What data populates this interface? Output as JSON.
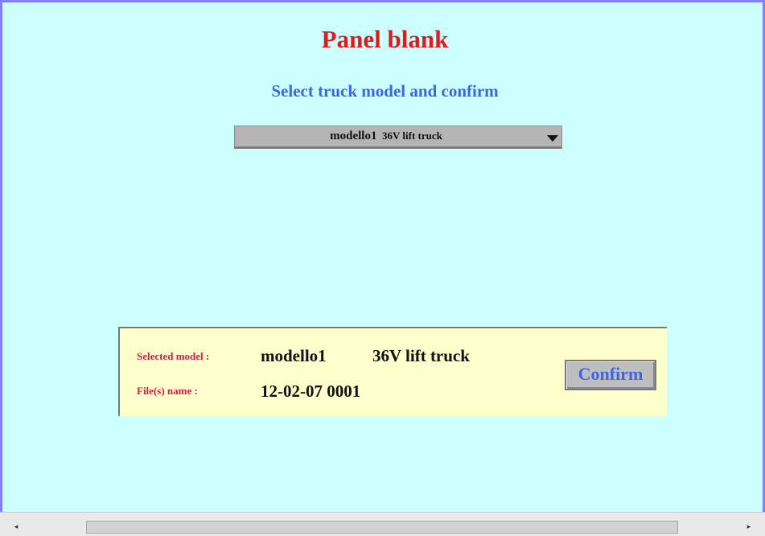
{
  "page": {
    "title": "Panel blank",
    "subtitle": "Select truck model  and confirm"
  },
  "model_select": {
    "model": "modello1",
    "description": "36V lift truck",
    "arrow_icon": "triangle-down"
  },
  "summary": {
    "selected_model_label": "Selected model :",
    "selected_model": "modello1",
    "selected_description": "36V lift truck",
    "file_name_label": "File(s) name :",
    "file_name": "12-02-07 0001",
    "confirm_label": "Confirm"
  },
  "scrollbar": {
    "left_icon": "◂",
    "right_icon": "▸"
  },
  "colors": {
    "background": "#ccffff",
    "title": "#e41a1a",
    "subtitle": "#3c64e6",
    "panel": "#ffffcc",
    "label": "#e0184a"
  }
}
